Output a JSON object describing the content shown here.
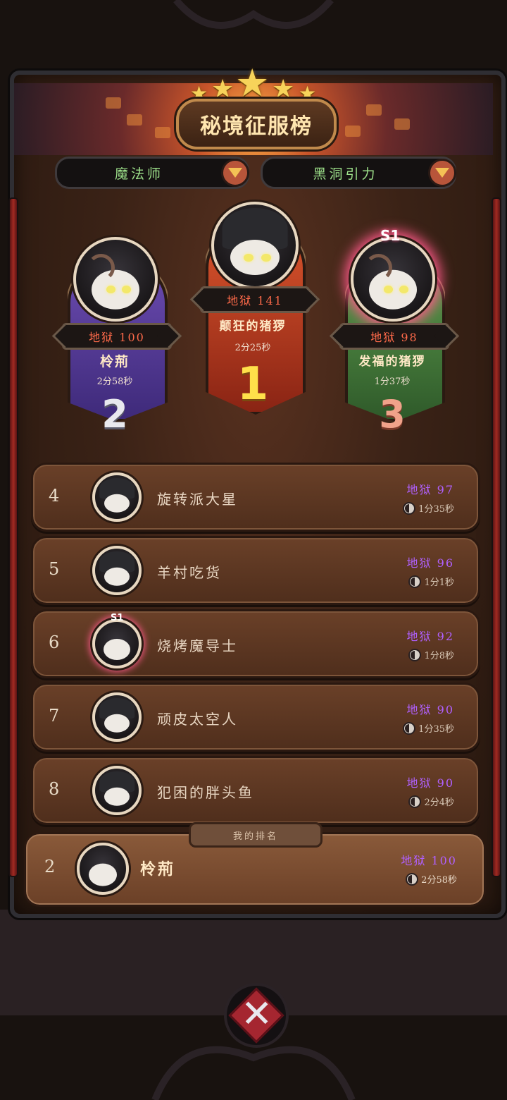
{
  "title": "秘境征服榜",
  "stars": 5,
  "filters": {
    "class": {
      "label": "魔法师"
    },
    "mode": {
      "label": "黑洞引力"
    }
  },
  "podium": [
    {
      "rank": "1",
      "level": "地狱 141",
      "name": "颠狂的猪猡",
      "time": "2分25秒"
    },
    {
      "rank": "2",
      "level": "地狱 100",
      "name": "柃荊",
      "time": "2分58秒"
    },
    {
      "rank": "3",
      "level": "地狱 98",
      "name": "发福的猪猡",
      "time": "1分37秒",
      "season_badge": "S1"
    }
  ],
  "list": [
    {
      "rank": "4",
      "name": "旋转派大星",
      "level": "地狱 97",
      "time": "1分35秒"
    },
    {
      "rank": "5",
      "name": "羊村吃货",
      "level": "地狱 96",
      "time": "1分1秒"
    },
    {
      "rank": "6",
      "name": "烧烤魔导士",
      "level": "地狱 92",
      "time": "1分8秒",
      "season_badge": "S1"
    },
    {
      "rank": "7",
      "name": "顽皮太空人",
      "level": "地狱 90",
      "time": "1分35秒"
    },
    {
      "rank": "8",
      "name": "犯困的胖头鱼",
      "level": "地狱 90",
      "time": "2分4秒"
    }
  ],
  "my_rank": {
    "tag": "我的排名",
    "rank": "2",
    "name": "柃荊",
    "level": "地狱 100",
    "time": "2分58秒"
  },
  "colors": {
    "podium_first": "#d9542c",
    "podium_second": "#6b4bb0",
    "podium_third": "#5c9a4c",
    "level_text": "#b060ff",
    "dropdown_text": "#9de08a"
  },
  "icons": [
    "dropdown-arrow-icon",
    "clock-icon",
    "close-icon",
    "star-icon"
  ]
}
